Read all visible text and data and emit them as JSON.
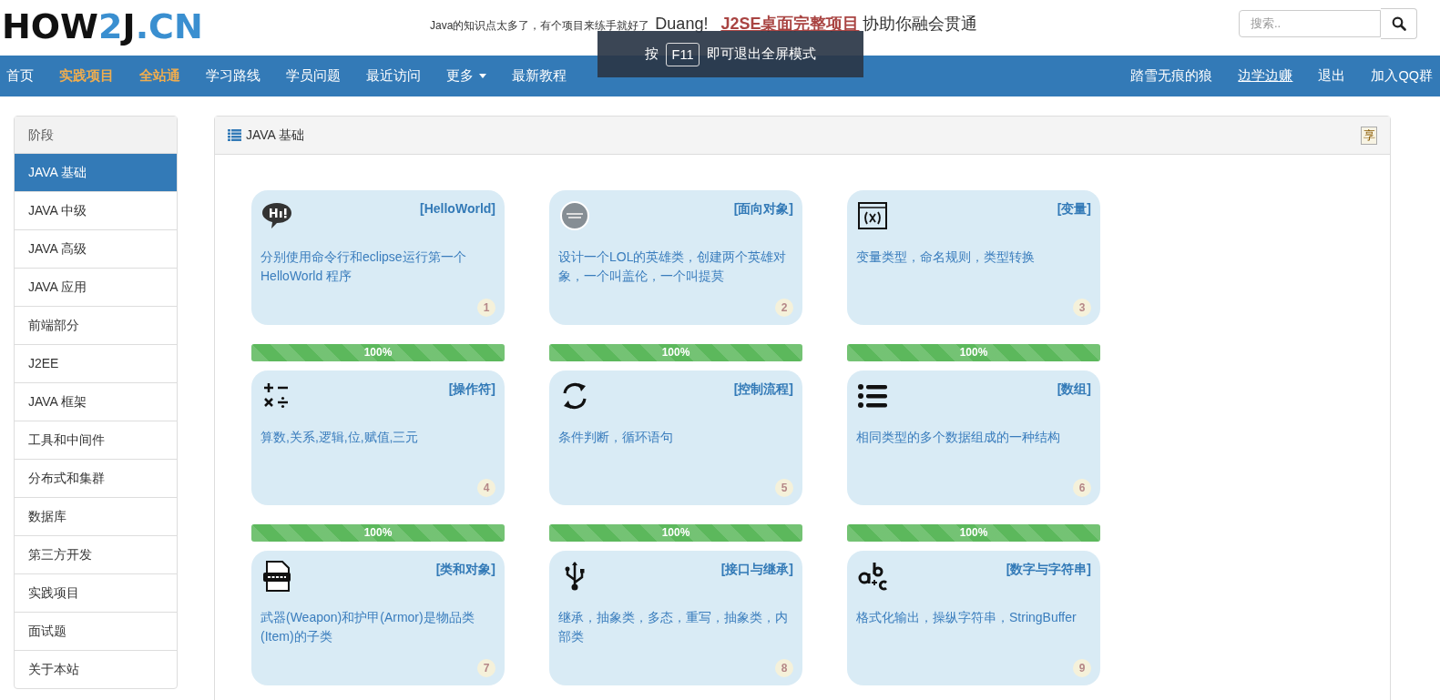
{
  "logo": [
    {
      "text": "HOW",
      "accent": false
    },
    {
      "text": "2",
      "accent": true
    },
    {
      "text": "J",
      "accent": false
    },
    {
      "text": ".CN",
      "accent": true
    }
  ],
  "slogan": {
    "lead": "Java的知识点太多了，有个项目来练手就好了",
    "shout": "Duang!",
    "link": "J2SE桌面完整项目",
    "tail": "协助你融会贯通"
  },
  "search": {
    "placeholder": "搜索.."
  },
  "nav_left": [
    {
      "label": "首页",
      "highlight": false,
      "dropdown": false
    },
    {
      "label": "实践项目",
      "highlight": true,
      "dropdown": false
    },
    {
      "label": "全站通",
      "highlight": true,
      "dropdown": false
    },
    {
      "label": "学习路线",
      "highlight": false,
      "dropdown": false
    },
    {
      "label": "学员问题",
      "highlight": false,
      "dropdown": false
    },
    {
      "label": "最近访问",
      "highlight": false,
      "dropdown": false
    },
    {
      "label": "更多",
      "highlight": false,
      "dropdown": true
    },
    {
      "label": "最新教程",
      "highlight": false,
      "dropdown": false
    }
  ],
  "nav_right": [
    {
      "label": "踏雪无痕的狼",
      "underline": false
    },
    {
      "label": "边学边赚",
      "underline": true
    },
    {
      "label": "退出",
      "underline": false
    },
    {
      "label": "加入QQ群",
      "underline": false
    }
  ],
  "fullscreen_notice": {
    "before": "按",
    "key": "F11",
    "after": "即可退出全屏模式"
  },
  "sidebar": {
    "heading": "阶段",
    "items": [
      {
        "label": "JAVA 基础",
        "selected": true
      },
      {
        "label": "JAVA 中级",
        "selected": false
      },
      {
        "label": "JAVA 高级",
        "selected": false
      },
      {
        "label": "JAVA 应用",
        "selected": false
      },
      {
        "label": "前端部分",
        "selected": false
      },
      {
        "label": "J2EE",
        "selected": false
      },
      {
        "label": "JAVA 框架",
        "selected": false
      },
      {
        "label": "工具和中间件",
        "selected": false
      },
      {
        "label": "分布式和集群",
        "selected": false
      },
      {
        "label": "数据库",
        "selected": false
      },
      {
        "label": "第三方开发",
        "selected": false
      },
      {
        "label": "实践项目",
        "selected": false
      },
      {
        "label": "面试题",
        "selected": false
      },
      {
        "label": "关于本站",
        "selected": false
      }
    ]
  },
  "panel": {
    "title": "JAVA 基础",
    "share_button": "享"
  },
  "cards": [
    {
      "kind": "hi",
      "title": "[HelloWorld]",
      "description": "分别使用命令行和eclipse运行第一个HelloWorld 程序",
      "number": "1",
      "progress": {
        "level": 1,
        "label": "100%"
      }
    },
    {
      "kind": "emblem",
      "title": "[面向对象]",
      "description": "设计一个LOL的英雄类，创建两个英雄对象，一个叫盖伦，一个叫提莫",
      "number": "2",
      "progress": {
        "level": 1,
        "label": "100%"
      }
    },
    {
      "kind": "variable",
      "title": "[变量]",
      "description": "变量类型，命名规则，类型转换",
      "number": "3",
      "progress": {
        "level": 1,
        "label": "100%"
      }
    },
    {
      "kind": "operators",
      "title": "[操作符]",
      "description": "算数,关系,逻辑,位,赋值,三元",
      "number": "4",
      "progress": {
        "level": 1,
        "label": "100%"
      }
    },
    {
      "kind": "loop",
      "title": "[控制流程]",
      "description": "条件判断，循环语句",
      "number": "5",
      "progress": {
        "level": 1,
        "label": "100%"
      }
    },
    {
      "kind": "list",
      "title": "[数组]",
      "description": "相同类型的多个数据组成的一种结构",
      "number": "6",
      "progress": {
        "level": 1,
        "label": "100%"
      }
    },
    {
      "kind": "classfile",
      "title": "[类和对象]",
      "description": "武器(Weapon)和护甲(Armor)是物品类(Item)的子类",
      "number": "7"
    },
    {
      "kind": "usb",
      "title": "[接口与继承]",
      "description": "继承，抽象类，多态，重写，抽象类，内部类",
      "number": "8"
    },
    {
      "kind": "letters",
      "title": "[数字与字符串]",
      "description": "格式化输出，操纵字符串，StringBuffer",
      "number": "9"
    }
  ]
}
